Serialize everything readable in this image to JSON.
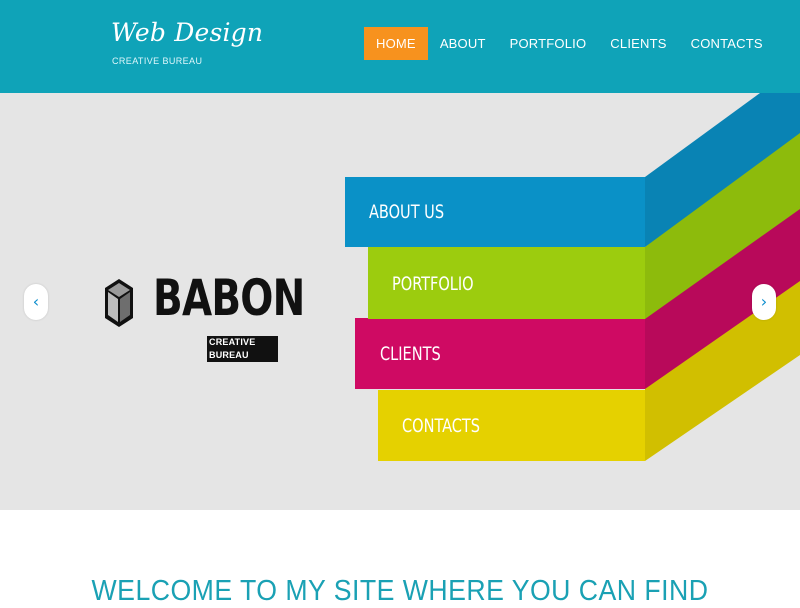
{
  "brand": {
    "title": "Web Design",
    "subtitle": "CREATIVE BUREAU"
  },
  "nav": {
    "items": [
      "HOME",
      "ABOUT",
      "PORTFOLIO",
      "CLIENTS",
      "CONTACTS"
    ],
    "active_index": 0
  },
  "slider": {
    "prev_icon": "chevron-left-icon",
    "next_icon": "chevron-right-icon",
    "logo": {
      "word": "BABON",
      "tagline": "CREATIVE BUREAU"
    },
    "ribbons": [
      {
        "label": "ABOUT US",
        "color": "#0a91c7"
      },
      {
        "label": "PORTFOLIO",
        "color": "#9ccc0e"
      },
      {
        "label": "CLIENTS",
        "color": "#cf0a63"
      },
      {
        "label": "CONTACTS",
        "color": "#e5d100"
      }
    ]
  },
  "welcome": {
    "heading": "WELCOME TO MY SITE WHERE YOU CAN FIND"
  },
  "colors": {
    "header_bg": "#0fa3b8",
    "accent": "#f7921e",
    "hero_bg": "#e5e5e5",
    "heading": "#1aa1b4"
  }
}
